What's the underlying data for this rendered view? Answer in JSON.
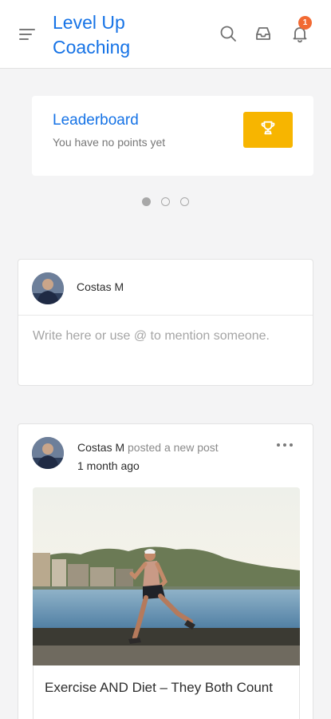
{
  "header": {
    "app_title": "Level Up Coaching",
    "notification_count": "1",
    "icons": [
      "menu-icon",
      "search-icon",
      "inbox-icon",
      "bell-icon"
    ],
    "accent_color": "#1673e6",
    "badge_color": "#f26a33"
  },
  "leaderboard": {
    "title": "Leaderboard",
    "subtitle": "You have no points yet",
    "button_icon": "trophy-icon",
    "button_color": "#f7b500"
  },
  "carousel": {
    "total": 3,
    "active_index": 0
  },
  "composer": {
    "user_name": "Costas M",
    "placeholder": "Write here or use @ to mention someone."
  },
  "post": {
    "author": "Costas M",
    "action": "posted a new post",
    "time": "1 month ago",
    "title": "Exercise AND Diet – They Both Count",
    "image_alt": "runner-by-the-water-photo"
  }
}
